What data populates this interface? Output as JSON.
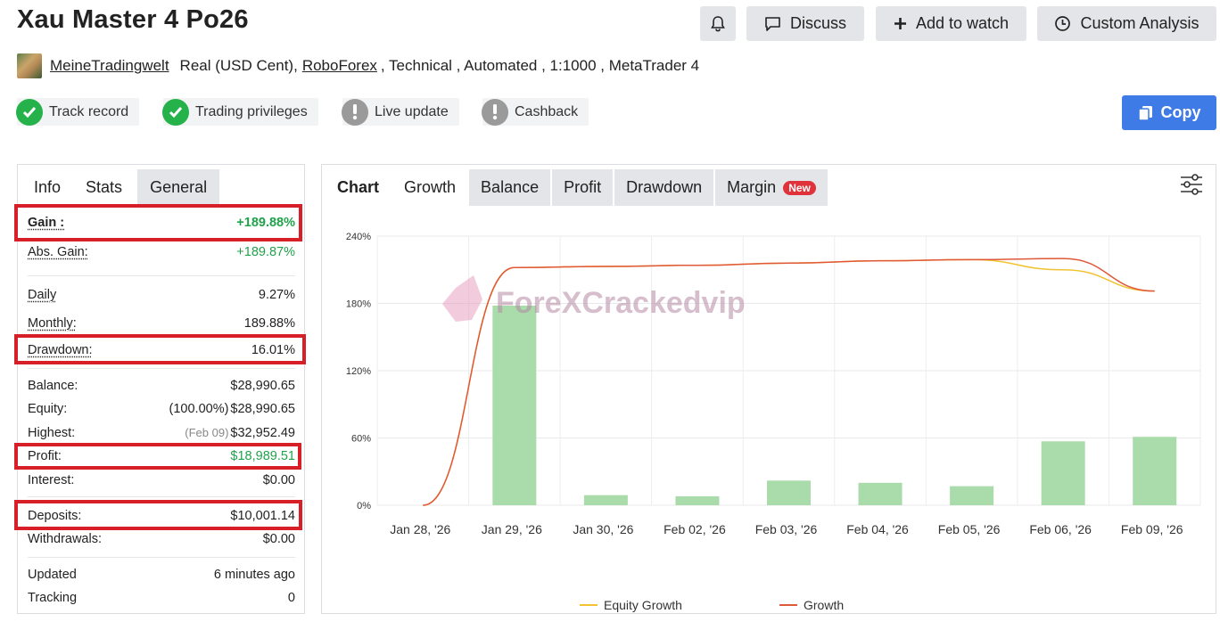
{
  "header": {
    "title": "Xau Master 4 Po26",
    "discuss_label": "Discuss",
    "watch_label": "Add to watch",
    "analysis_label": "Custom Analysis"
  },
  "meta": {
    "author": "MeineTradingwelt",
    "account_type": "Real (USD Cent),",
    "broker": "RoboForex",
    "details": ", Technical , Automated , 1:1000 , MetaTrader 4"
  },
  "badges": [
    {
      "label": "Track record",
      "status": "ok"
    },
    {
      "label": "Trading privileges",
      "status": "ok"
    },
    {
      "label": "Live update",
      "status": "warn"
    },
    {
      "label": "Cashback",
      "status": "warn"
    }
  ],
  "copy_label": "Copy",
  "left_tabs": [
    "Info",
    "Stats",
    "General"
  ],
  "stats": {
    "gain": {
      "label": "Gain :",
      "value": "+189.88%"
    },
    "abs_gain": {
      "label": "Abs. Gain:",
      "value": "+189.87%"
    },
    "daily": {
      "label": "Daily",
      "value": "9.27%"
    },
    "monthly": {
      "label": "Monthly:",
      "value": "189.88%"
    },
    "drawdown": {
      "label": "Drawdown:",
      "value": "16.01%"
    },
    "balance": {
      "label": "Balance:",
      "value": "$28,990.65"
    },
    "equity": {
      "label": "Equity:",
      "note": "(100.00%)",
      "value": "$28,990.65"
    },
    "highest": {
      "label": "Highest:",
      "note": "(Feb 09)",
      "value": "$32,952.49"
    },
    "profit": {
      "label": "Profit:",
      "value": "$18,989.51"
    },
    "interest": {
      "label": "Interest:",
      "value": "$0.00"
    },
    "deposits": {
      "label": "Deposits:",
      "value": "$10,001.14"
    },
    "withdrawals": {
      "label": "Withdrawals:",
      "value": "$0.00"
    },
    "updated": {
      "label": "Updated",
      "value": "6 minutes ago"
    },
    "tracking": {
      "label": "Tracking",
      "value": "0"
    }
  },
  "chart_tabs": {
    "chart": "Chart",
    "growth": "Growth",
    "balance": "Balance",
    "profit": "Profit",
    "drawdown": "Drawdown",
    "margin": "Margin",
    "new_badge": "New"
  },
  "watermark": "ForeXCrackedvip",
  "colors": {
    "accent": "#3e7be6",
    "green": "#20a24a",
    "red_highlight": "#d61f26",
    "bar": "#a9dcaa",
    "growth_line": "#e0583a",
    "equity_line": "#f2c230"
  },
  "chart_data": {
    "type": "bar",
    "categories": [
      "Jan 28, '26",
      "Jan 29, '26",
      "Jan 30, '26",
      "Feb 02, '26",
      "Feb 03, '26",
      "Feb 04, '26",
      "Feb 05, '26",
      "Feb 06, '26",
      "Feb 09, '26"
    ],
    "yticks": [
      "0%",
      "60%",
      "120%",
      "180%",
      "240%"
    ],
    "ylim": [
      0,
      240
    ],
    "bars": [
      0,
      178,
      9,
      8,
      22,
      20,
      17,
      57,
      61
    ],
    "series": [
      {
        "name": "Equity Growth",
        "values": [
          0,
          212,
          213,
          214,
          216,
          218,
          219,
          210,
          191
        ]
      },
      {
        "name": "Growth",
        "values": [
          0,
          212,
          213,
          214,
          216,
          218,
          219,
          220,
          191
        ]
      }
    ],
    "grid": true,
    "legend": "bottom"
  }
}
